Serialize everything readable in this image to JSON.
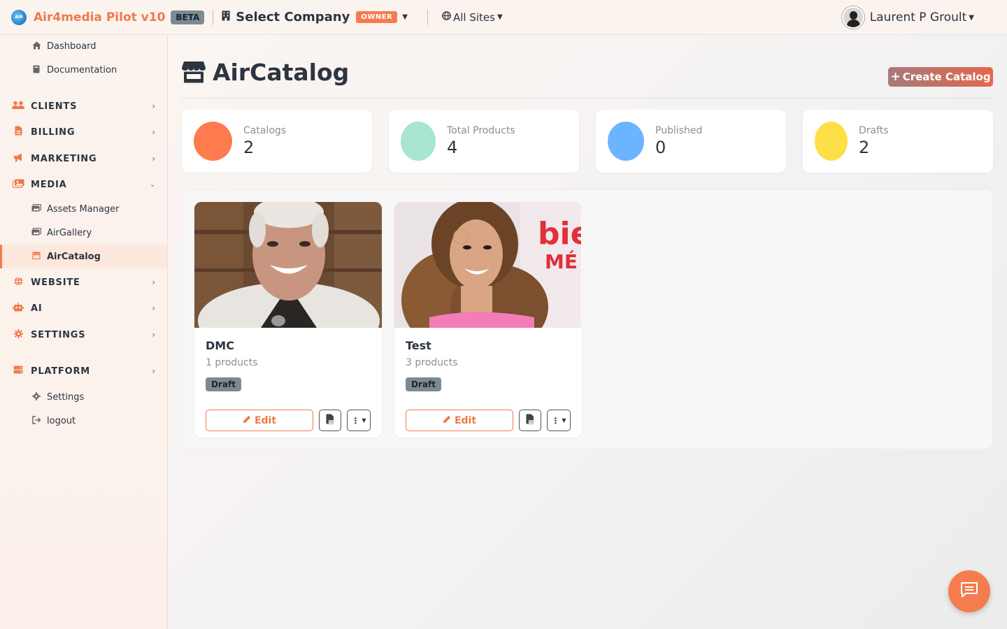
{
  "topbar": {
    "logo_text": "AIR",
    "brand_name": "Air4media Pilot v10",
    "beta_label": "BETA",
    "company_label": "Select Company",
    "owner_label": "OWNER",
    "sites_label": "All Sites",
    "user_name": "Laurent P Groult"
  },
  "sidebar": {
    "top_links": [
      {
        "label": "Dashboard",
        "icon": "home-icon"
      },
      {
        "label": "Documentation",
        "icon": "book-icon"
      }
    ],
    "sections": [
      {
        "label": "CLIENTS",
        "icon": "users-icon",
        "expanded": false
      },
      {
        "label": "BILLING",
        "icon": "file-invoice-icon",
        "expanded": false
      },
      {
        "label": "MARKETING",
        "icon": "bullhorn-icon",
        "expanded": false
      },
      {
        "label": "MEDIA",
        "icon": "images-icon",
        "expanded": true
      },
      {
        "label": "WEBSITE",
        "icon": "globe-icon",
        "expanded": false
      },
      {
        "label": "AI",
        "icon": "robot-icon",
        "expanded": false
      },
      {
        "label": "SETTINGS",
        "icon": "gear-icon",
        "expanded": false
      },
      {
        "label": "PLATFORM",
        "icon": "server-icon",
        "expanded": false
      }
    ],
    "media_links": [
      {
        "label": "Assets Manager",
        "icon": "images-icon"
      },
      {
        "label": "AirGallery",
        "icon": "images-icon"
      },
      {
        "label": "AirCatalog",
        "icon": "store-icon",
        "active": true
      }
    ],
    "platform_links": [
      {
        "label": "Settings",
        "icon": "gear-icon"
      },
      {
        "label": "logout",
        "icon": "logout-icon"
      }
    ]
  },
  "main": {
    "title": "AirCatalog",
    "create_button": "Create Catalog",
    "stats": [
      {
        "label": "Catalogs",
        "value": "2",
        "color": "#ff7b4d"
      },
      {
        "label": "Total Products",
        "value": "4",
        "color": "#a8e6cf"
      },
      {
        "label": "Published",
        "value": "0",
        "color": "#6cb4ff"
      },
      {
        "label": "Drafts",
        "value": "2",
        "color": "#fde047"
      }
    ],
    "catalogs": [
      {
        "name": "DMC",
        "count": "1 products",
        "status": "Draft",
        "edit_label": "Edit"
      },
      {
        "name": "Test",
        "count": "3 products",
        "status": "Draft",
        "edit_label": "Edit"
      }
    ]
  },
  "colors": {
    "accent": "#f47b4f",
    "text": "#2c3540",
    "muted": "#8a8f94"
  }
}
